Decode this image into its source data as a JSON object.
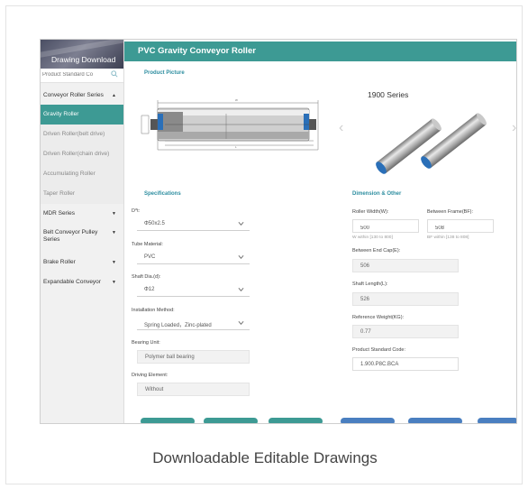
{
  "sidebar": {
    "banner_title": "Drawing Download",
    "search_placeholder": "Product Standard Co",
    "items": [
      {
        "label": "Conveyor Roller Series",
        "arrow": "▲"
      },
      {
        "label": "Gravity Roller"
      },
      {
        "label": "Driven Roller(belt drive)"
      },
      {
        "label": "Driven Roller(chain drive)"
      },
      {
        "label": "Accumulating Roller"
      },
      {
        "label": "Taper Roller"
      },
      {
        "label": "MDR Series",
        "arrow": "▼"
      },
      {
        "label": "Belt Conveyor Pulley Series",
        "arrow": "▼"
      },
      {
        "label": "Brake Roller",
        "arrow": "▼"
      },
      {
        "label": "Expandable Conveyor",
        "arrow": "▼"
      }
    ]
  },
  "main": {
    "title": "PVC Gravity Conveyor Roller",
    "product_picture_title": "Product Picture",
    "series_label": "1900 Series",
    "specs": {
      "title": "Specifications",
      "fields": [
        {
          "label": "D*t:",
          "value": "Φ50x2.5"
        },
        {
          "label": "Tube Material:",
          "value": "PVC"
        },
        {
          "label": "Shaft Dia.(d):",
          "value": "Φ12"
        },
        {
          "label": "Installation Method:",
          "value": "Spring Loaded，Zinc-plated"
        },
        {
          "label": "Bearing Unit:",
          "value": "Polymer ball bearing"
        },
        {
          "label": "Driving Element:",
          "value": "Without"
        }
      ]
    },
    "dimension": {
      "title": "Dimension & Other",
      "roller_width_label": "Roller Width(W):",
      "roller_width_value": "500",
      "roller_width_hint": "W within [130 to 800]",
      "between_frame_label": "Between Frame(BF):",
      "between_frame_value": "508",
      "between_frame_hint": "BF within [138 to 808]",
      "end_cap_label": "Between End Cap(E):",
      "end_cap_value": "506",
      "shaft_length_label": "Shaft Length(L):",
      "shaft_length_value": "526",
      "weight_label": "Reference Weight(KG):",
      "weight_value": "0.77",
      "code_label": "Product Standard Code:",
      "code_value": "1.900.P8C.BCA"
    }
  },
  "caption": "Downloadable Editable Drawings",
  "colors": {
    "accent": "#3d9a94",
    "section_title": "#2e8ea0",
    "roller_cap": "#2a6fb8"
  },
  "icons": {
    "search": "search-icon",
    "dropdown": "chevron-down-icon",
    "prev": "chevron-left-icon",
    "next": "chevron-right-icon"
  }
}
